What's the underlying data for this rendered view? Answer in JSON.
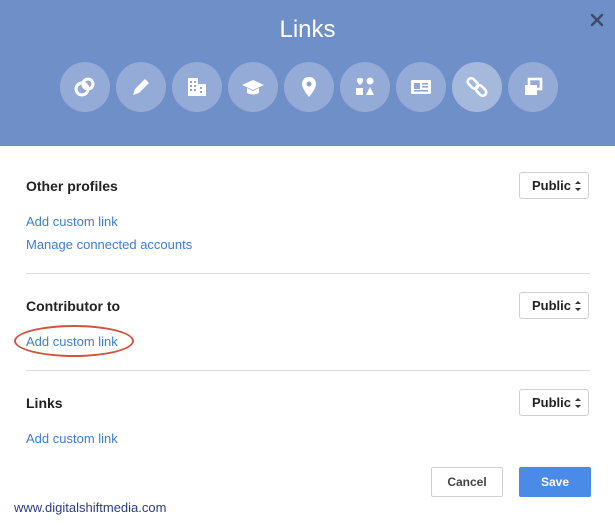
{
  "dialog": {
    "title": "Links",
    "close_icon": "close-icon"
  },
  "tabs": [
    {
      "icon": "circles-icon",
      "active": false
    },
    {
      "icon": "pencil-icon",
      "active": false
    },
    {
      "icon": "building-icon",
      "active": false
    },
    {
      "icon": "graduation-cap-icon",
      "active": false
    },
    {
      "icon": "map-pin-icon",
      "active": false
    },
    {
      "icon": "shapes-icon",
      "active": false
    },
    {
      "icon": "contact-card-icon",
      "active": false
    },
    {
      "icon": "link-icon",
      "active": true
    },
    {
      "icon": "windows-icon",
      "active": false
    }
  ],
  "sections": {
    "other_profiles": {
      "title": "Other profiles",
      "visibility": "Public",
      "links": [
        "Add custom link",
        "Manage connected accounts"
      ]
    },
    "contributor_to": {
      "title": "Contributor to",
      "visibility": "Public",
      "links": [
        "Add custom link"
      ]
    },
    "links": {
      "title": "Links",
      "visibility": "Public",
      "links": [
        "Add custom link"
      ]
    }
  },
  "buttons": {
    "cancel": "Cancel",
    "save": "Save"
  },
  "watermark": "www.digitalshiftmedia.com",
  "colors": {
    "header": "#6f8fc8",
    "link": "#3b7fd4",
    "save": "#4a8be8",
    "highlight": "#d0553e"
  }
}
